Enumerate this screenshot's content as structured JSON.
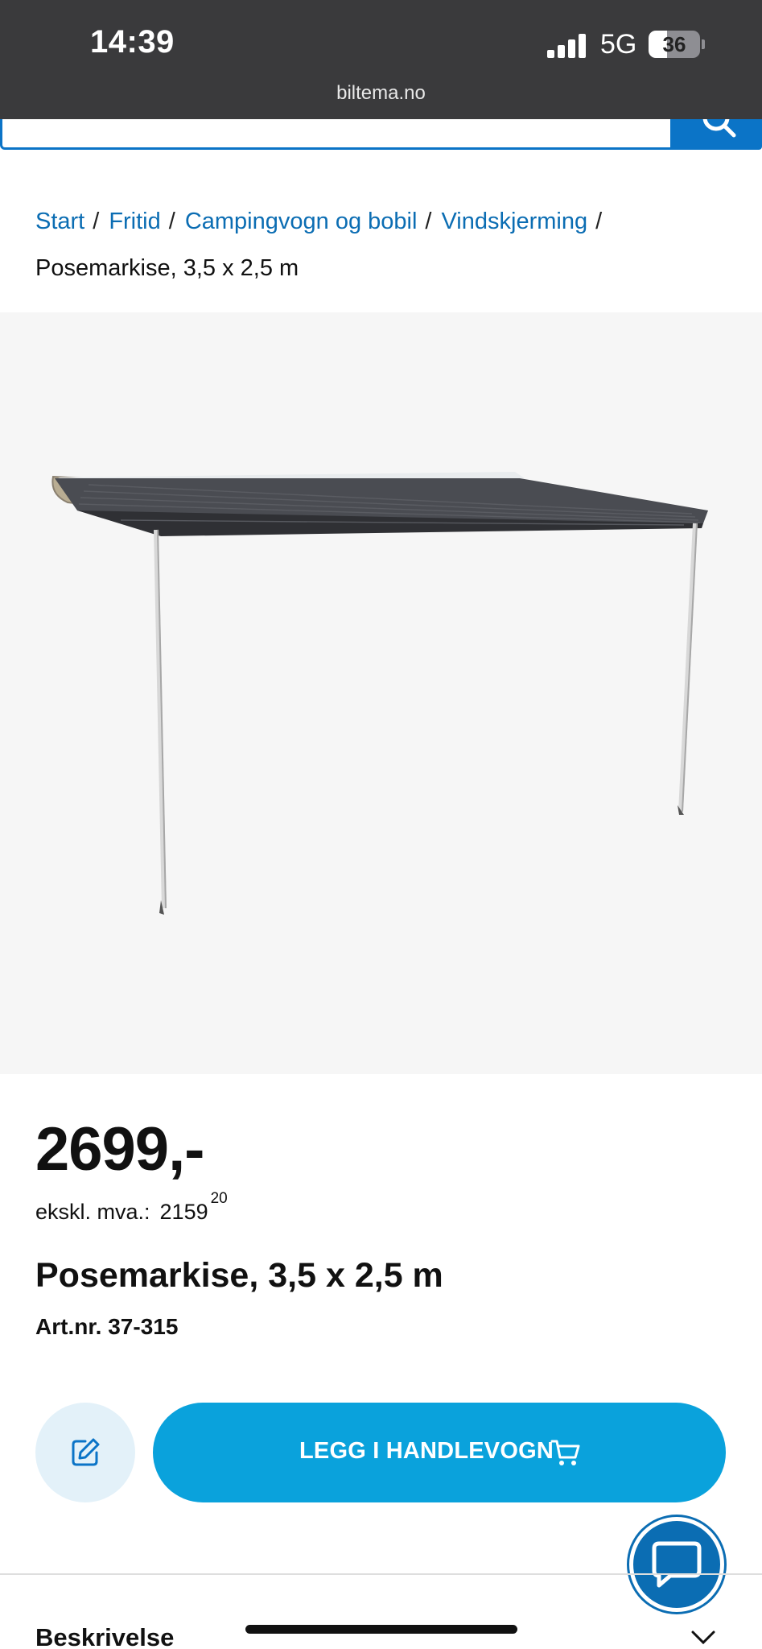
{
  "status_bar": {
    "time": "14:39",
    "network": "5G",
    "battery": "36",
    "battery_level": 0.36,
    "signal_bars": 4
  },
  "browser": {
    "url": "biltema.no"
  },
  "breadcrumb": {
    "items": [
      {
        "label": "Start"
      },
      {
        "label": "Fritid"
      },
      {
        "label": "Campingvogn og bobil"
      },
      {
        "label": "Vindskjerming"
      }
    ],
    "separator": "/",
    "current": "Posemarkise, 3,5 x 2,5 m"
  },
  "product": {
    "image_icon": "awning-product-image",
    "price": "2699,-",
    "excl_vat_label": "ekskl. mva.:",
    "excl_vat_value": "2159",
    "excl_vat_decimals": "20",
    "title": "Posemarkise, 3,5 x 2,5 m",
    "article_number": "Art.nr. 37-315"
  },
  "actions": {
    "edit_icon": "edit-note-icon",
    "add_to_cart_label": "LEGG I HANDLEVOGN",
    "cart_icon": "cart-icon",
    "chat_icon": "chat-bubble-icon"
  },
  "sections": {
    "description_label": "Beskrivelse"
  },
  "colors": {
    "link": "#0b6db3",
    "primary_button": "#0aa2dc",
    "search_blue": "#0b74c7",
    "status_bar": "#3a3a3c"
  }
}
